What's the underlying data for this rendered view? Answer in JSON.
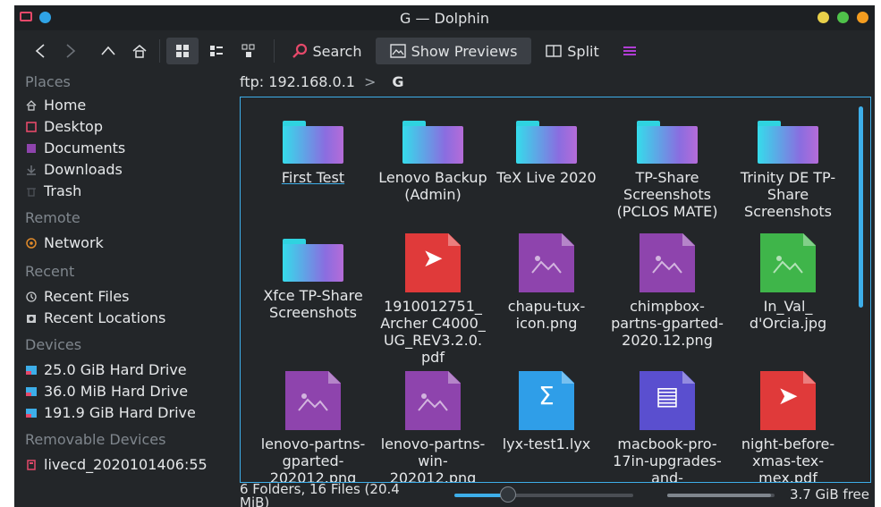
{
  "window": {
    "title": "G — Dolphin",
    "colors": {
      "close": "#f39c1f",
      "maximize": "#4fc24a",
      "minimize": "#e9d04a",
      "accent": "#3daee9"
    }
  },
  "toolbar": {
    "back_icon": "chevron-left-icon",
    "forward_icon": "chevron-right-icon",
    "up_icon": "chevron-up-icon",
    "home_icon": "home-icon",
    "search_label": "Search",
    "show_previews_label": "Show Previews",
    "split_label": "Split",
    "menu_icon": "hamburger-icon"
  },
  "sidebar": {
    "sections": [
      {
        "title": "Places",
        "items": [
          {
            "label": "Home",
            "icon": "home-icon"
          },
          {
            "label": "Desktop",
            "icon": "desktop-icon"
          },
          {
            "label": "Documents",
            "icon": "documents-icon"
          },
          {
            "label": "Downloads",
            "icon": "downloads-icon"
          },
          {
            "label": "Trash",
            "icon": "trash-icon"
          }
        ]
      },
      {
        "title": "Remote",
        "items": [
          {
            "label": "Network",
            "icon": "network-icon"
          }
        ]
      },
      {
        "title": "Recent",
        "items": [
          {
            "label": "Recent Files",
            "icon": "recent-files-icon"
          },
          {
            "label": "Recent Locations",
            "icon": "recent-locations-icon"
          }
        ]
      },
      {
        "title": "Devices",
        "items": [
          {
            "label": "25.0 GiB Hard Drive",
            "icon": "harddrive-icon"
          },
          {
            "label": "36.0 MiB Hard Drive",
            "icon": "harddrive-icon"
          },
          {
            "label": "191.9 GiB Hard Drive",
            "icon": "harddrive-icon"
          }
        ]
      },
      {
        "title": "Removable Devices",
        "items": [
          {
            "label": "livecd_2020101406:55",
            "icon": "removable-drive-icon"
          }
        ]
      }
    ]
  },
  "breadcrumb": {
    "root": "ftp: 192.168.0.1",
    "separator": ">",
    "current": "G"
  },
  "files": [
    {
      "name": "First Test",
      "kind": "folder"
    },
    {
      "name": "Lenovo Backup (Admin)",
      "kind": "folder"
    },
    {
      "name": "TeX Live 2020",
      "kind": "folder"
    },
    {
      "name": "TP-Share Screenshots (PCLOS MATE)",
      "kind": "folder"
    },
    {
      "name": "Trinity DE TP-Share Screenshots",
      "kind": "folder"
    },
    {
      "name": "Xfce TP-Share Screenshots",
      "kind": "folder"
    },
    {
      "name": "1910012751_ Archer C4000_ UG_REV3.2.0. pdf",
      "kind": "pdf"
    },
    {
      "name": "chapu-tux-icon.png",
      "kind": "image-purple"
    },
    {
      "name": "chimpbox-partns-gparted-2020.12.png",
      "kind": "image-purple"
    },
    {
      "name": "In_Val_ d'Orcia.jpg",
      "kind": "image-green"
    },
    {
      "name": "lenovo-partns-gparted-202012.png",
      "kind": "image-purple"
    },
    {
      "name": "lenovo-partns-win-202012.png",
      "kind": "image-purple"
    },
    {
      "name": "lyx-test1.lyx",
      "kind": "lyx"
    },
    {
      "name": "macbook-pro-17in-upgrades-and-",
      "kind": "document"
    },
    {
      "name": "night-before-xmas-tex-mex.pdf",
      "kind": "pdf"
    }
  ],
  "status": {
    "summary": "6 Folders, 16 Files (20.4 MiB)",
    "zoom_fraction": 0.3,
    "free_space": "3.7 GiB free",
    "used_fraction": 0.97
  }
}
